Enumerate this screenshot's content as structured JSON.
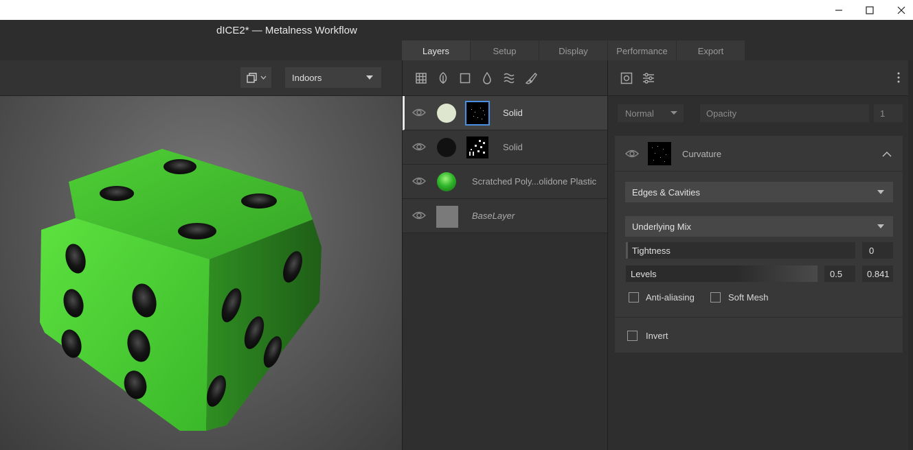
{
  "window": {
    "title": "dICE2* — Metalness Workflow"
  },
  "tabs": [
    {
      "label": "Layers",
      "active": true
    },
    {
      "label": "Setup",
      "active": false
    },
    {
      "label": "Display",
      "active": false
    },
    {
      "label": "Performance",
      "active": false
    },
    {
      "label": "Export",
      "active": false
    }
  ],
  "viewport": {
    "environment": "Indoors",
    "camera_icon": "camera-view-icon"
  },
  "layers_toolbar": {
    "icons": [
      "grid-icon",
      "leaf-icon",
      "square-icon",
      "droplet-icon",
      "waves-icon",
      "brush-icon"
    ]
  },
  "layers": [
    {
      "name": "Solid",
      "swatch": "#dfe6cf",
      "selected": true
    },
    {
      "name": "Solid",
      "swatch": "#111111",
      "selected": false
    },
    {
      "name": "Scratched Poly...olidone Plastic",
      "swatch": "#2fb52a",
      "selected": false
    },
    {
      "name": "BaseLayer",
      "swatch": "#7a7a7a",
      "selected": false
    }
  ],
  "properties": {
    "blend_mode": "Normal",
    "opacity_label": "Opacity",
    "opacity_value": "1",
    "effect": {
      "name": "Curvature",
      "mode": "Edges & Cavities",
      "mix": "Underlying Mix",
      "tightness_label": "Tightness",
      "tightness_value": "0",
      "levels_label": "Levels",
      "levels_low": "0.5",
      "levels_high": "0.841",
      "anti_aliasing_label": "Anti-aliasing",
      "soft_mesh_label": "Soft Mesh",
      "invert_label": "Invert"
    }
  },
  "colors": {
    "accent": "#4a90e2",
    "dice_green": "#3fc22c"
  }
}
